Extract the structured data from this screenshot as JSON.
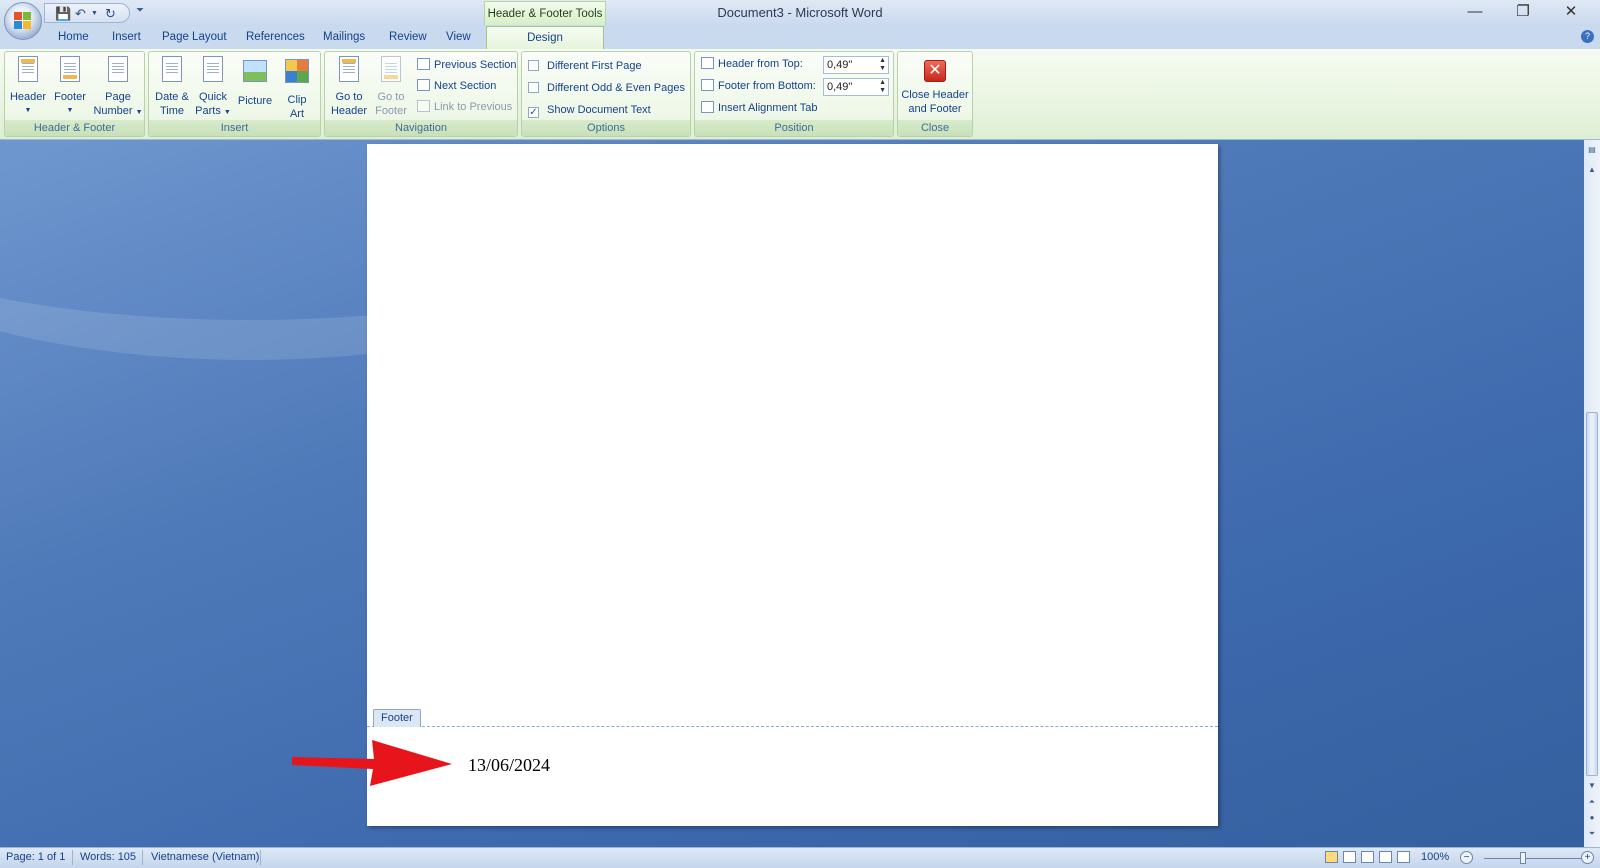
{
  "window": {
    "title": "Document3 - Microsoft Word",
    "contextual_tab_group": "Header & Footer Tools"
  },
  "tabs": [
    {
      "label": "Home"
    },
    {
      "label": "Insert"
    },
    {
      "label": "Page Layout"
    },
    {
      "label": "References"
    },
    {
      "label": "Mailings"
    },
    {
      "label": "Review"
    },
    {
      "label": "View"
    },
    {
      "label": "Design"
    }
  ],
  "ribbon": {
    "header_footer": {
      "label": "Header & Footer",
      "header": "Header",
      "footer": "Footer",
      "page_number_1": "Page",
      "page_number_2": "Number"
    },
    "insert": {
      "label": "Insert",
      "date_time_1": "Date &",
      "date_time_2": "Time",
      "quick_parts_1": "Quick",
      "quick_parts_2": "Parts",
      "picture": "Picture",
      "clip_art_1": "Clip",
      "clip_art_2": "Art"
    },
    "navigation": {
      "label": "Navigation",
      "go_to_header_1": "Go to",
      "go_to_header_2": "Header",
      "go_to_footer_1": "Go to",
      "go_to_footer_2": "Footer",
      "previous_section": "Previous Section",
      "next_section": "Next Section",
      "link_to_previous": "Link to Previous"
    },
    "options": {
      "label": "Options",
      "different_first_page": "Different First Page",
      "different_odd_even": "Different Odd & Even Pages",
      "show_document_text": "Show Document Text"
    },
    "position": {
      "label": "Position",
      "header_from_top": "Header from Top:",
      "header_from_top_value": "0,49\"",
      "footer_from_bottom": "Footer from Bottom:",
      "footer_from_bottom_value": "0,49\"",
      "insert_alignment_tab": "Insert Alignment Tab"
    },
    "close": {
      "label": "Close",
      "close_1": "Close Header",
      "close_2": "and Footer"
    }
  },
  "document": {
    "footer_tag": "Footer",
    "footer_text": "13/06/2024"
  },
  "status_bar": {
    "page": "Page: 1 of 1",
    "words": "Words: 105",
    "language": "Vietnamese (Vietnam)",
    "zoom": "100%"
  },
  "colors": {
    "annotation_arrow": "#e8141c",
    "ribbon_accent": "#15428b"
  }
}
